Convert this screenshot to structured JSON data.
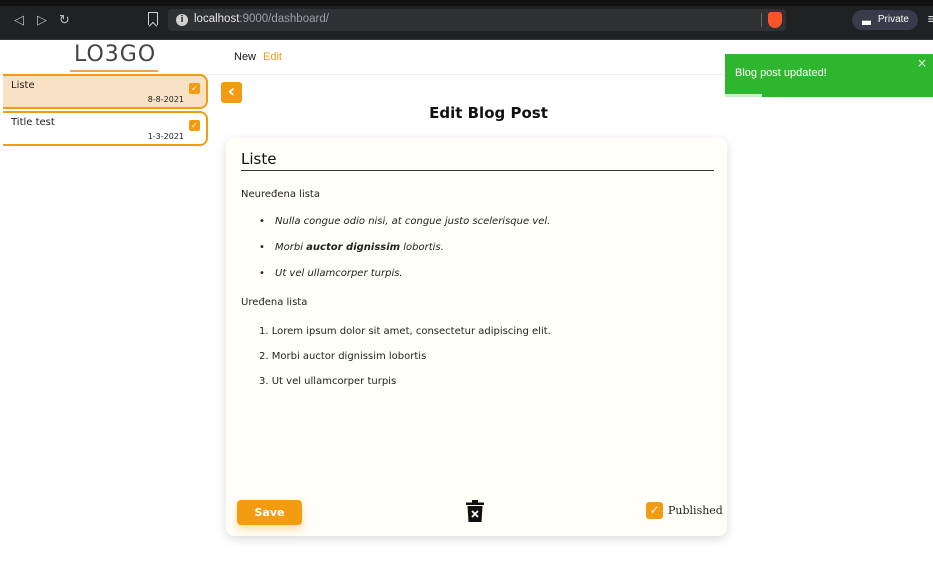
{
  "browser": {
    "url_host": "localhost",
    "url_path": ":9000/dashboard/",
    "private_label": "Private"
  },
  "header": {
    "logo": "LO3GO",
    "nav_new": "New",
    "nav_edit": "Edit"
  },
  "sidebar": {
    "posts": [
      {
        "title": "Liste",
        "date": "8-8-2021",
        "published": true,
        "active": true
      },
      {
        "title": "Title test",
        "date": "1-3-2021",
        "published": true,
        "active": false
      }
    ]
  },
  "page": {
    "back_glyph": "‹",
    "title": "Edit Blog Post"
  },
  "editor": {
    "post_title": "Liste",
    "heading_unordered": "Neuređena lista",
    "unordered_items": [
      {
        "pre": "Nulla congue odio nisi, at congue justo scelerisque vel.",
        "bold": "",
        "post": ""
      },
      {
        "pre": "Morbi ",
        "bold": "auctor dignissim",
        "post": " lobortis."
      },
      {
        "pre": "Ut vel ullamcorper turpis.",
        "bold": "",
        "post": ""
      }
    ],
    "heading_ordered": "Uređena lista",
    "ordered_items": [
      {
        "num": "1.",
        "text": "Lorem ipsum dolor sit amet, consectetur adipiscing elit."
      },
      {
        "num": "2.",
        "text": "Morbi auctor dignissim lobortis"
      },
      {
        "num": "3.",
        "text": "Ut vel ullamcorper turpis"
      }
    ]
  },
  "footer": {
    "save_label": "Save",
    "published_label": "Published",
    "published": true
  },
  "toast": {
    "message": "Blog post updated!",
    "close": "×"
  },
  "colors": {
    "accent": "#f39c12",
    "toast": "#2fb62f"
  }
}
